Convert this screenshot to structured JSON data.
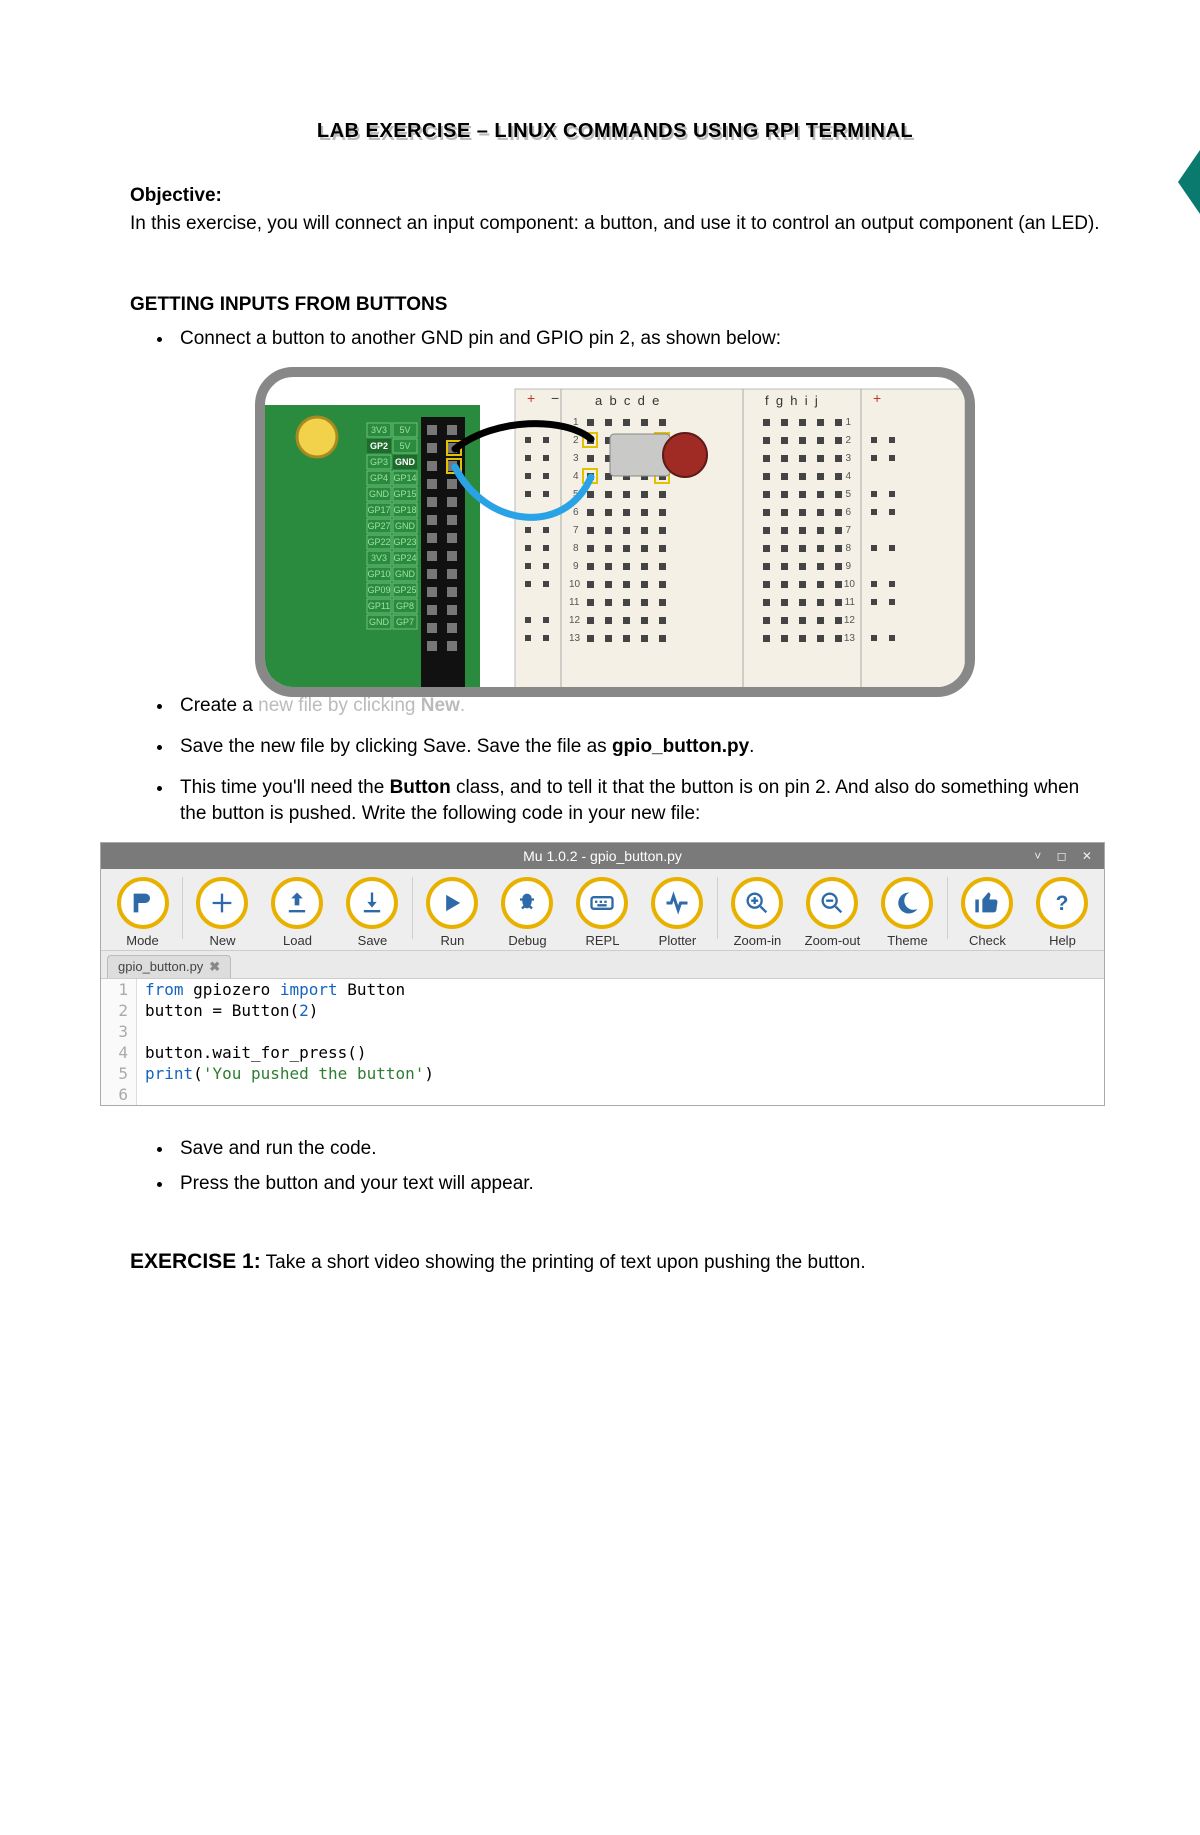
{
  "title": "LAB EXERCISE – LINUX COMMANDS USING RPI TERMINAL",
  "objective": {
    "heading": "Objective:",
    "text": "In this exercise, you will connect an input component: a button, and use it to control an output component (an LED)."
  },
  "section1": {
    "heading": "GETTING INPUTS FROM BUTTONS",
    "bullets": {
      "b1": "Connect a button to another GND pin and GPIO pin 2, as shown below:",
      "b2_pre": "Create a ",
      "b2_mid": "new file by clicking ",
      "b2_bold": "New",
      "b2_end": ".",
      "b3_pre": "Save the new file by clicking Save. Save the file as ",
      "b3_bold": "gpio_button.py",
      "b3_end": ".",
      "b4_pre": "This time you'll need the ",
      "b4_bold": "Button",
      "b4_post": " class, and to tell it that the button is on pin 2. And also do something when the button is pushed. Write the following code in your new file:"
    },
    "bullets2": {
      "b5": "Save and run the code.",
      "b6": "Press the button and your text will appear."
    }
  },
  "mu": {
    "title": "Mu 1.0.2 - gpio_button.py",
    "winbuttons": "˅  ◻  ✕",
    "toolbar": [
      "Mode",
      "New",
      "Load",
      "Save",
      "Run",
      "Debug",
      "REPL",
      "Plotter",
      "Zoom-in",
      "Zoom-out",
      "Theme",
      "Check",
      "Help"
    ],
    "tab": {
      "name": "gpio_button.py",
      "close": "✖"
    },
    "code": {
      "l1": {
        "n": "1",
        "kw1": "from",
        "t1": " gpiozero ",
        "kw2": "import",
        "t2": " Button"
      },
      "l2": {
        "n": "2",
        "t1": "button = Button(",
        "num": "2",
        "t2": ")"
      },
      "l3": {
        "n": "3",
        "t": ""
      },
      "l4": {
        "n": "4",
        "t": "button.wait_for_press()"
      },
      "l5": {
        "n": "5",
        "fn": "print",
        "t1": "(",
        "str": "'You pushed the button'",
        "t2": ")"
      },
      "l6": {
        "n": "6",
        "t": ""
      }
    }
  },
  "exercise": {
    "label": "EXERCISE 1:",
    "text": " Take a short video showing the printing of text upon pushing the button."
  },
  "breadboard": {
    "header_left": "a  b  c  d  e",
    "header_right": "f  g  h  i  j",
    "pins": {
      "r1": [
        "3V3",
        "5V"
      ],
      "r2": [
        "GP2",
        "5V"
      ],
      "r3": [
        "GP3",
        "GND"
      ],
      "r4": [
        "GP4",
        "GP14"
      ],
      "r5": [
        "GND",
        "GP15"
      ],
      "r6": [
        "GP17",
        "GP18"
      ],
      "r7": [
        "GP27",
        "GND"
      ],
      "r8": [
        "GP22",
        "GP23"
      ],
      "r9": [
        "3V3",
        "GP24"
      ],
      "r10": [
        "GP10",
        "GND"
      ],
      "r11": [
        "GP09",
        "GP25"
      ],
      "r12": [
        "GP11",
        "GP8"
      ],
      "r13": [
        "GND",
        "GP7"
      ]
    }
  }
}
